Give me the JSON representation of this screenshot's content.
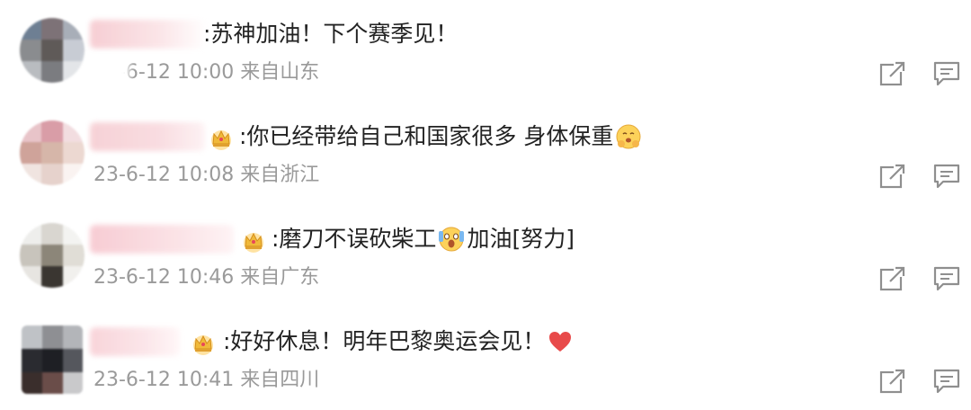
{
  "colors": {
    "text": "#222222",
    "meta": "#9a9a9a",
    "icon": "#8f8f8f",
    "heart": "#e84a4a",
    "crown": "#f0b93a"
  },
  "comments": [
    {
      "text": ":苏神加油！下个赛季见！",
      "time": "23-6-12 10:00",
      "location": "来自山东",
      "meta_partially_hidden": true
    },
    {
      "text_parts": [
        ":你已经带给自己和国家很多  身体保重"
      ],
      "time": "23-6-12 10:08",
      "location": "来自浙江",
      "trailing_emoji": "hug-face-emoji"
    },
    {
      "text_parts": [
        ":磨刀不误砍柴工",
        " 加油[努力]"
      ],
      "time": "23-6-12 10:46",
      "location": "来自广东",
      "mid_emoji": "screaming-face-emoji"
    },
    {
      "text_parts": [
        ":好好休息！明年巴黎奥运会见！"
      ],
      "time": "23-6-12 10:41",
      "location": "来自四川",
      "trailing_emoji": "red-heart-emoji"
    }
  ],
  "icons": {
    "share": "share-icon",
    "reply": "comment-icon",
    "badge": "crown-badge-icon"
  }
}
